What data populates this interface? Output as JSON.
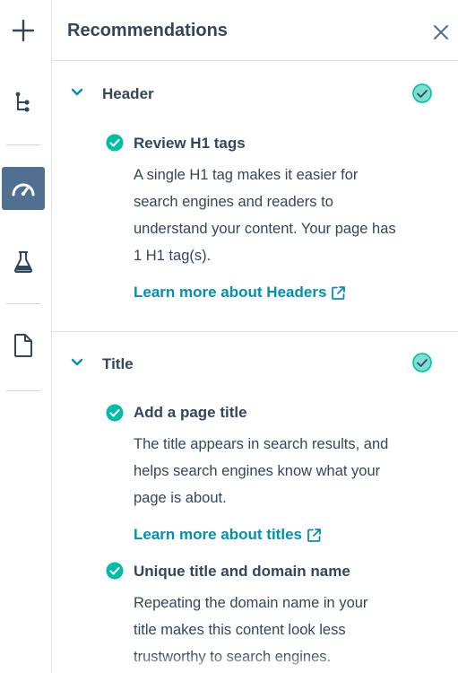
{
  "rail": {
    "icons": [
      "add-icon",
      "tree-icon",
      "speedometer-icon",
      "flask-icon",
      "document-icon"
    ]
  },
  "panel": {
    "title": "Recommendations"
  },
  "sections": {
    "header": {
      "title": "Header",
      "items": [
        {
          "title": "Review H1 tags",
          "desc": [
            "A single H1 tag makes it easier for",
            "search engines and readers to",
            "understand your content. Your page has",
            "1 H1 tag(s)."
          ],
          "link": "Learn more about Headers"
        }
      ]
    },
    "title": {
      "title": "Title",
      "items": [
        {
          "title": "Add a page title",
          "desc": [
            "The title appears in search results, and",
            "helps search engines know what your",
            "page is about."
          ],
          "link": "Learn more about titles"
        },
        {
          "title": "Unique title and domain name",
          "desc": [
            "Repeating the domain name in your",
            "title makes this content look less",
            "trustworthy to search engines."
          ]
        }
      ]
    }
  },
  "colors": {
    "accent": "#0091ae",
    "success": "#00bda5",
    "text": "#33475b",
    "rail_active": "#516f90"
  }
}
